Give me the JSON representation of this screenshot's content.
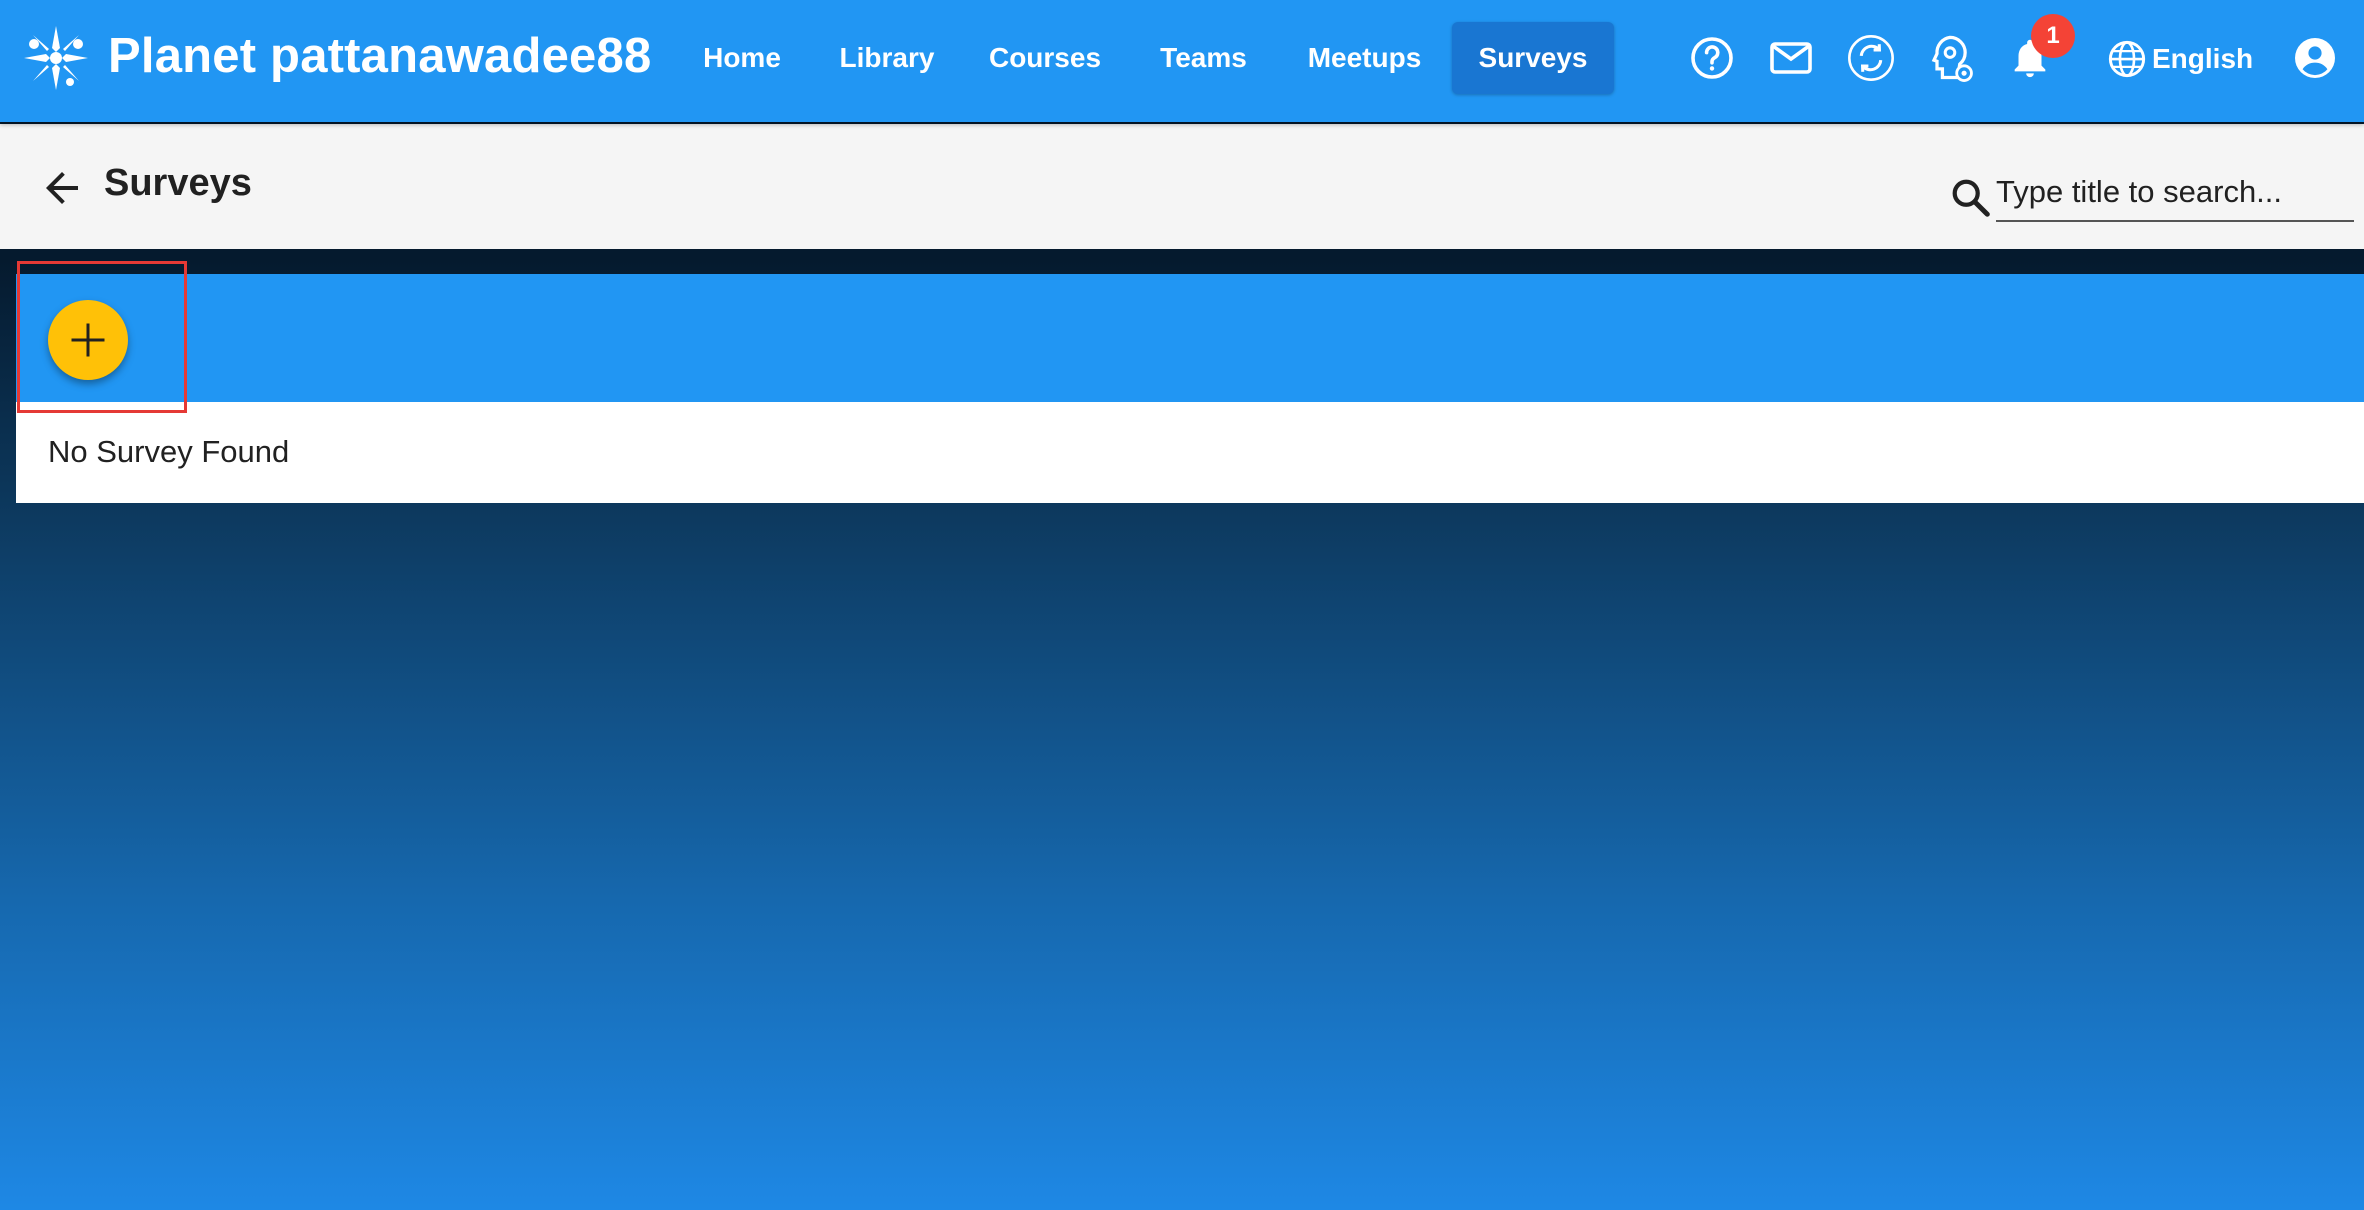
{
  "app": {
    "title": "Planet pattanawadee88",
    "logo_icon": "planet-logo-icon"
  },
  "nav": {
    "items": [
      {
        "label": "Home",
        "active": false
      },
      {
        "label": "Library",
        "active": false
      },
      {
        "label": "Courses",
        "active": false
      },
      {
        "label": "Teams",
        "active": false
      },
      {
        "label": "Meetups",
        "active": false
      },
      {
        "label": "Surveys",
        "active": true
      }
    ]
  },
  "toolbar_icons": {
    "help": "help-circle-icon",
    "mail": "mail-icon",
    "sync": "sync-icon",
    "manager": "user-settings-icon",
    "notifications": "bell-icon",
    "notification_count": "1",
    "language_icon": "globe-icon",
    "language": "English",
    "account": "account-circle-icon"
  },
  "page": {
    "title": "Surveys",
    "back_icon": "arrow-back-icon",
    "search_icon": "search-icon",
    "search_placeholder": "Type title to search...",
    "search_value": ""
  },
  "surveys": {
    "add_icon": "plus-icon",
    "empty_message": "No Survey Found"
  },
  "colors": {
    "primary": "#2196f3",
    "active_nav": "#1976d2",
    "fab": "#ffc107",
    "badge": "#f44336",
    "highlight": "#e53935",
    "subbar": "#f5f5f5"
  }
}
